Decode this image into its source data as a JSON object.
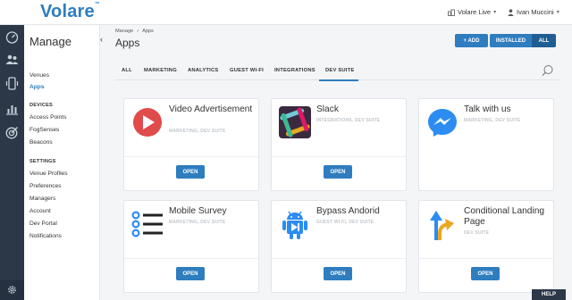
{
  "brand": {
    "logo": "Volare",
    "mark": "™"
  },
  "topbar": {
    "venue": "Volare Live",
    "user": "Ivan Muccini"
  },
  "rail_icons": [
    "dashboard-icon",
    "users-icon",
    "devices-icon",
    "analytics-icon",
    "target-icon"
  ],
  "sidebar": {
    "title": "Manage",
    "group1": [
      {
        "label": "Venues"
      },
      {
        "label": "Apps"
      }
    ],
    "devices_header": "DEVICES",
    "devices": [
      {
        "label": "Access Points"
      },
      {
        "label": "FogSenses"
      },
      {
        "label": "Beacons"
      }
    ],
    "settings_header": "SETTINGS",
    "settings": [
      {
        "label": "Venue Profiles"
      },
      {
        "label": "Preferences"
      },
      {
        "label": "Managers"
      },
      {
        "label": "Account"
      },
      {
        "label": "Dev Portal"
      },
      {
        "label": "Notifications"
      }
    ]
  },
  "breadcrumb": [
    "Manage",
    "Apps"
  ],
  "page_title": "Apps",
  "actions": {
    "add": "+ ADD",
    "installed": "INSTALLED",
    "all": "ALL"
  },
  "tabs": [
    "ALL",
    "MARKETING",
    "ANALYTICS",
    "GUEST WI-FI",
    "INTEGRATIONS",
    "DEV SUITE"
  ],
  "active_tab": "DEV SUITE",
  "cards": [
    {
      "name": "Video Advertisement",
      "categories": "MARKETING, DEV SUITE",
      "button": "OPEN",
      "icon": "video-play-icon"
    },
    {
      "name": "Slack",
      "categories": "INTEGRATIONS, DEV SUITE",
      "button": "OPEN",
      "icon": "slack-icon"
    },
    {
      "name": "Talk with us",
      "categories": "MARKETING, DEV SUITE",
      "button": "",
      "icon": "messenger-icon"
    },
    {
      "name": "Mobile Survey",
      "categories": "MARKETING, DEV SUITE",
      "button": "OPEN",
      "icon": "survey-list-icon"
    },
    {
      "name": "Bypass Andorid",
      "categories": "GUEST WI-FI, DEV SUITE",
      "button": "OPEN",
      "icon": "android-icon"
    },
    {
      "name": "Conditional Landing Page",
      "categories": "DEV SUITE",
      "button": "OPEN",
      "icon": "conditional-arrows-icon"
    }
  ],
  "help": "HELP",
  "colors": {
    "accent": "#2e7dbf",
    "rail": "#2c3848"
  }
}
